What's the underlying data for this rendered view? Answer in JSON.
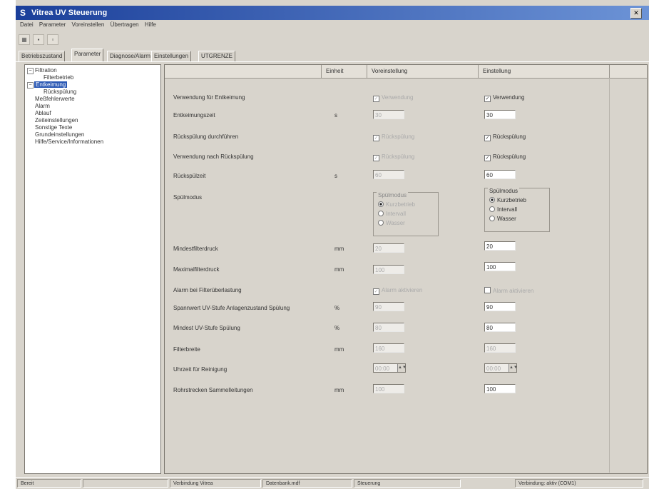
{
  "window": {
    "title": "Vitrea UV Steuerung"
  },
  "menu": [
    "Datei",
    "Parameter",
    "Voreinstellen",
    "Übertragen",
    "Hilfe"
  ],
  "tabs": [
    "Betriebszustand",
    "Parameter",
    "Diagnose/Alarm",
    "Einstellungen",
    "UTGRENZE"
  ],
  "active_tab": 1,
  "tree": [
    {
      "label": "Filtration",
      "level": 0,
      "expander": "-"
    },
    {
      "label": "Filterbetrieb",
      "level": 1
    },
    {
      "label": "Entkeimung",
      "level": 0,
      "expander": "-",
      "selected": true
    },
    {
      "label": "Rückspülung",
      "level": 1
    },
    {
      "label": "Meßfehlerwerte",
      "level": 0
    },
    {
      "label": "Alarm",
      "level": 0
    },
    {
      "label": "Ablauf",
      "level": 0
    },
    {
      "label": "Zeiteinstellungen",
      "level": 0
    },
    {
      "label": "Sonstige Texte",
      "level": 0
    },
    {
      "label": "Grundeinstellungen",
      "level": 0
    },
    {
      "label": "Hilfe/Service/Informationen",
      "level": 0
    }
  ],
  "grid_header": {
    "name": "",
    "unit": "Einheit",
    "default": "Voreinstellung",
    "setting": "Einstellung"
  },
  "rows": [
    {
      "label": "Verwendung für Entkeimung",
      "unit": "",
      "type": "check",
      "default": {
        "label": "Verwendung",
        "checked": true
      },
      "setting": {
        "label": "Verwendung",
        "checked": true
      }
    },
    {
      "label": "Entkeimungszeit",
      "unit": "s",
      "type": "field",
      "default": "30",
      "setting": "30"
    },
    {
      "label": "Rückspülung durchführen",
      "unit": "",
      "type": "check",
      "default": {
        "label": "Rückspülung",
        "checked": true
      },
      "setting": {
        "label": "Rückspülung",
        "checked": true
      }
    },
    {
      "label": "Verwendung nach Rückspülung",
      "unit": "",
      "type": "check",
      "default": {
        "label": "Rückspülung",
        "checked": true
      },
      "setting": {
        "label": "Rückspülung",
        "checked": true
      }
    },
    {
      "label": "Rückspülzeit",
      "unit": "s",
      "type": "field",
      "default": "60",
      "setting": "60"
    },
    {
      "label": "Spülmodus",
      "unit": "",
      "type": "group",
      "default": {
        "title": "Spülmodus",
        "options": [
          "Kurzbetrieb",
          "Intervall",
          "Wasser"
        ],
        "selected": 0
      },
      "setting": {
        "title": "Spülmodus",
        "options": [
          "Kurzbetrieb",
          "Intervall",
          "Wasser"
        ],
        "selected": 0
      }
    },
    {
      "label": "Mindestfilterdruck",
      "unit": "mm",
      "type": "field",
      "default": "20",
      "setting": "20"
    },
    {
      "label": "Maximalfilterdruck",
      "unit": "mm",
      "type": "field",
      "default": "100",
      "setting": "100"
    },
    {
      "label": "Alarm bei Filterüberlastung",
      "unit": "",
      "type": "check",
      "default": {
        "label": "Alarm aktivieren",
        "checked": true
      },
      "setting": {
        "label": "Alarm aktivieren",
        "checked": false
      }
    },
    {
      "label": "Spannwert UV-Stufe Anlagenzustand Spülung",
      "unit": "%",
      "type": "field",
      "default": "90",
      "setting": "90"
    },
    {
      "label": "Mindest UV-Stufe Spülung",
      "unit": "%",
      "type": "field",
      "default": "80",
      "setting": "80"
    },
    {
      "label": "Filterbreite",
      "unit": "mm",
      "type": "field",
      "default": "160",
      "setting": "160"
    },
    {
      "label": "Uhrzeit für Reinigung",
      "unit": "",
      "type": "spin",
      "default": "00:00",
      "setting": "00:00"
    },
    {
      "label": "Rohrstrecken Sammelleitungen",
      "unit": "mm",
      "type": "field",
      "default": "100",
      "setting": "100"
    }
  ],
  "status": [
    "Bereit",
    "",
    "Verbindung Vitrea",
    "Datenbank.mdf",
    "Steuerung",
    "Verbindung: aktiv (COM1)"
  ]
}
